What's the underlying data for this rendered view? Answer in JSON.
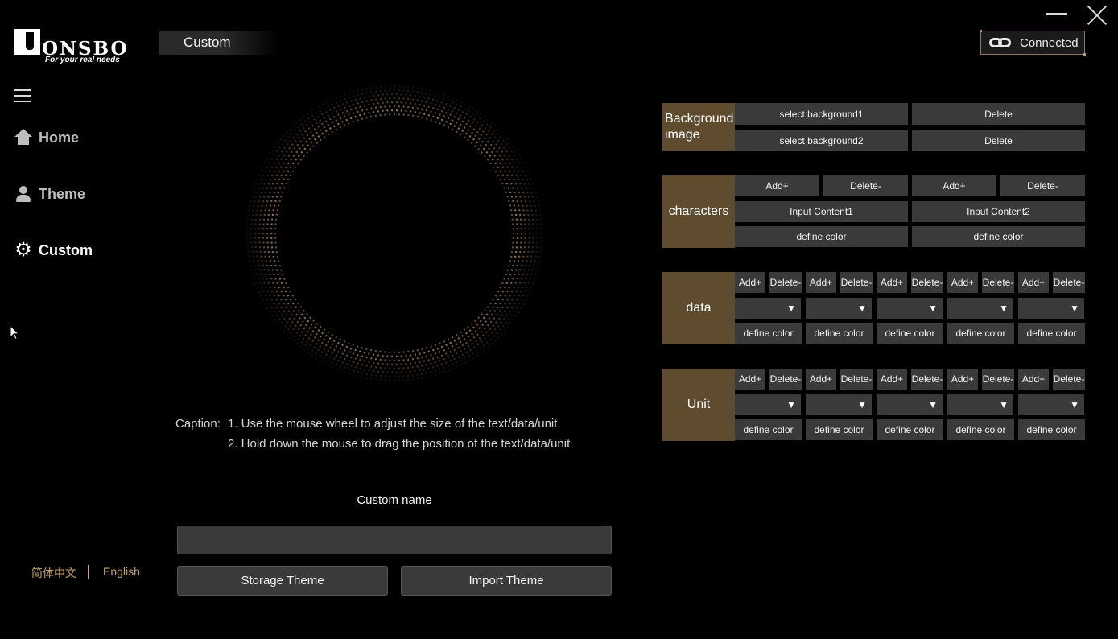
{
  "window": {
    "minimize_icon": "minimize-icon",
    "close_icon": "close-icon"
  },
  "logo": {
    "word": "ONSBO",
    "tagline": "For your real needs"
  },
  "header": {
    "page_title": "Custom",
    "status": "Connected",
    "status_icon": "link-icon"
  },
  "sidebar": {
    "menu_icon": "hamburger-icon",
    "items": [
      {
        "label": "Home",
        "icon": "home-icon"
      },
      {
        "label": "Theme",
        "icon": "user-icon"
      },
      {
        "label": "Custom",
        "icon": "gear-icon",
        "active": true
      }
    ],
    "languages": [
      "简体中文",
      "English"
    ]
  },
  "caption": {
    "label": "Caption:",
    "lines": [
      "1. Use the mouse wheel to adjust the size of the text/data/unit",
      "2. Hold down the mouse to drag the position of the text/data/unit"
    ]
  },
  "custom_name": {
    "label": "Custom name",
    "value": "",
    "placeholder": ""
  },
  "actions": {
    "storage": "Storage Theme",
    "import": "Import Theme"
  },
  "background": {
    "label": "Background image",
    "select1": "select background1",
    "select2": "select background2",
    "delete": "Delete"
  },
  "characters": {
    "label": "characters",
    "add": "Add+",
    "delete": "Delete-",
    "input1": "Input Content1",
    "input2": "Input Content2",
    "define_color": "define color"
  },
  "data_section": {
    "label": "data",
    "add": "Add+",
    "delete": "Delete-",
    "select_arrow": "▼",
    "define_color": "define color"
  },
  "unit_section": {
    "label": "Unit",
    "add": "Add+",
    "delete": "Delete-",
    "select_arrow": "▼",
    "define_color": "define color"
  },
  "colors": {
    "accent": "#5f4c2f",
    "button": "#3a3a3a",
    "lang": "#c9a66b",
    "ring": "#a5835a"
  }
}
